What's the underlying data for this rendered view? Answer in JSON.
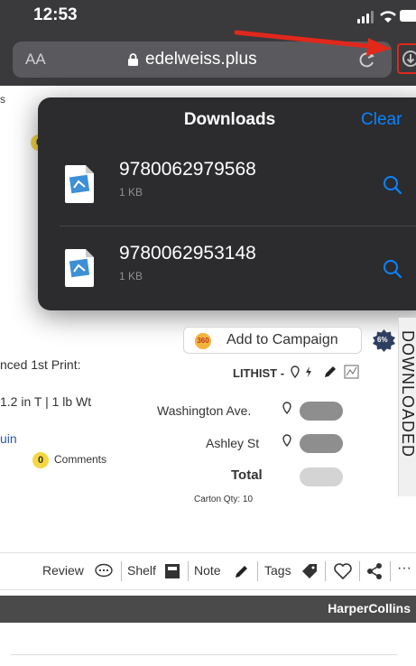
{
  "status_bar": {
    "time": "12:53"
  },
  "browser": {
    "text_size_label": "AA",
    "domain": "edelweiss.plus"
  },
  "downloads": {
    "title": "Downloads",
    "clear_label": "Clear",
    "items": [
      {
        "name": "9780062979568",
        "size": "1 KB"
      },
      {
        "name": "9780062953148",
        "size": "1 KB"
      }
    ]
  },
  "page_fragments": {
    "badge_top": "0",
    "letter_s": "s"
  },
  "product": {
    "add_to_campaign": "Add to Campaign",
    "campaign_icon": "360",
    "discount_badge": "6%",
    "print_label": "nced 1st Print:",
    "dimensions": "1.2 in T | 1 lb Wt",
    "publisher_link": "uin",
    "comment_count": "0",
    "comments_label": "Comments",
    "lithist_label": "LITHIST -",
    "stores": [
      {
        "name": "Washington Ave."
      },
      {
        "name": "Ashley St"
      }
    ],
    "total_label": "Total",
    "carton_qty": "Carton Qty: 10",
    "side_tab_label": "DOWNLOADED"
  },
  "actions": {
    "review": "Review",
    "shelf": "Shelf",
    "note": "Note",
    "tags": "Tags",
    "more": "···"
  },
  "publisher_bar": {
    "name": "HarperCollins"
  },
  "colors": {
    "accent_blue": "#0a84ff",
    "highlight_red": "#e0281b",
    "badge_yellow": "#f5d742",
    "toggle_grey": "#8e8e8e"
  }
}
